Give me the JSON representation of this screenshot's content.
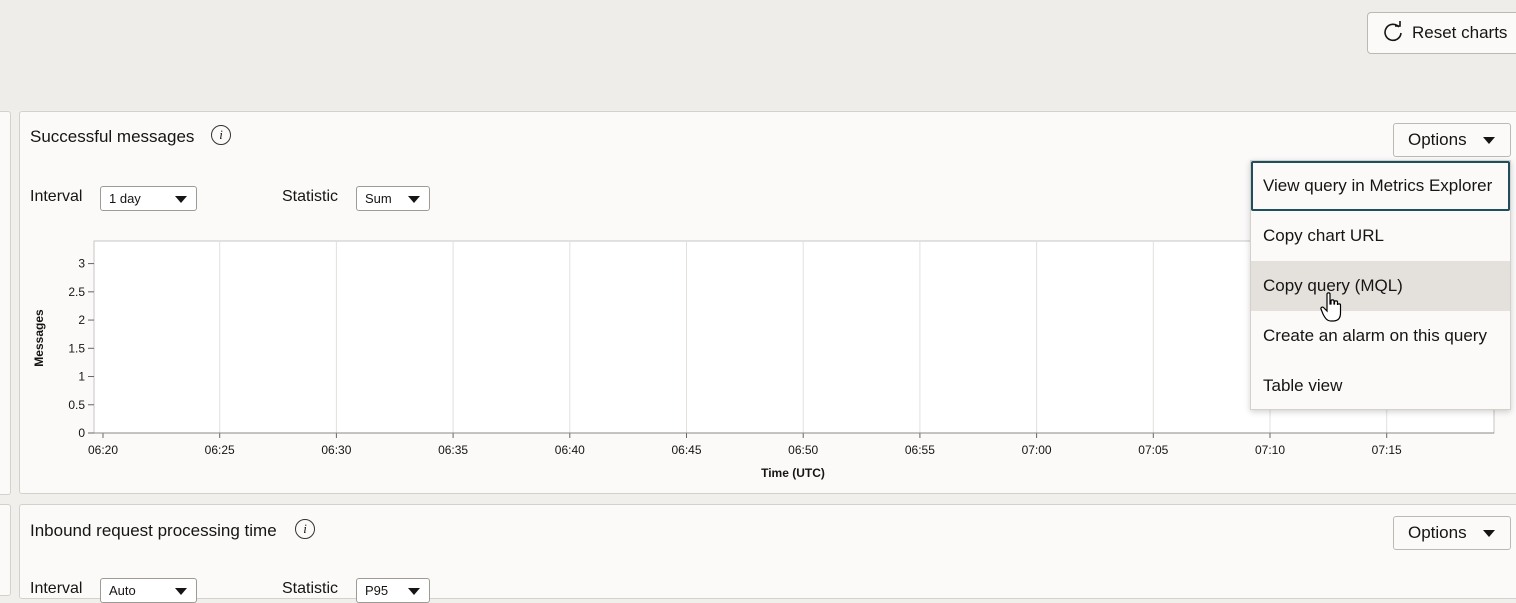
{
  "header": {
    "reset_label": "Reset charts"
  },
  "panels": [
    {
      "title": "Successful messages",
      "options_label": "Options",
      "interval_label": "Interval",
      "interval_value": "1 day",
      "statistic_label": "Statistic",
      "statistic_value": "Sum"
    },
    {
      "title": "Inbound request processing time",
      "options_label": "Options",
      "interval_label": "Interval",
      "interval_value": "Auto",
      "statistic_label": "Statistic",
      "statistic_value": "P95"
    }
  ],
  "options_menu": {
    "items": [
      "View query in Metrics Explorer",
      "Copy chart URL",
      "Copy query (MQL)",
      "Create an alarm on this query",
      "Table view"
    ]
  },
  "chart_data": {
    "type": "line",
    "title": "Successful messages",
    "xlabel": "Time (UTC)",
    "ylabel": "Messages",
    "x_ticks": [
      "06:20",
      "06:25",
      "06:30",
      "06:35",
      "06:40",
      "06:45",
      "06:50",
      "06:55",
      "07:00",
      "07:05",
      "07:10",
      "07:15"
    ],
    "y_ticks": [
      "0",
      "0.5",
      "1",
      "1.5",
      "2",
      "2.5",
      "3"
    ],
    "ylim": [
      0,
      3.4
    ],
    "series": [],
    "grid": "vertical"
  }
}
